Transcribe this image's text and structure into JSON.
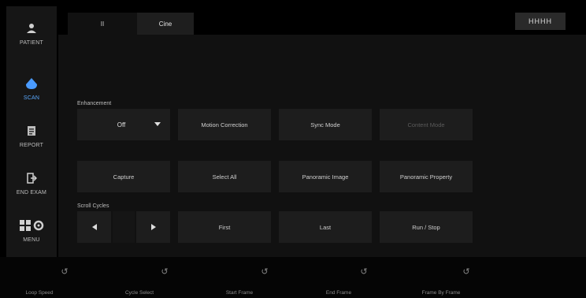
{
  "sidebar": {
    "items": [
      {
        "label": "PATIENT",
        "icon": "person-icon",
        "active": false
      },
      {
        "label": "SCAN",
        "icon": "probe-icon",
        "active": true
      },
      {
        "label": "REPORT",
        "icon": "report-icon",
        "active": false
      },
      {
        "label": "END EXAM",
        "icon": "exit-icon",
        "active": false
      },
      {
        "label": "MENU",
        "icon": "menu-gear-icon",
        "active": false
      }
    ]
  },
  "tabs": [
    {
      "label": "II"
    },
    {
      "label": "Cine"
    }
  ],
  "top_chip": {
    "label": "HHHH"
  },
  "enhancement": {
    "label": "Enhancement",
    "value": "Off"
  },
  "buttons": {
    "motion_correction": "Motion Correction",
    "sync_mode": "Sync Mode",
    "disabled_btn": "Content Mode",
    "capture": "Capture",
    "select_all": "Select All",
    "panoramic_image": "Panoramic Image",
    "panoramic_property": "Panoramic Property",
    "first": "First",
    "last": "Last",
    "run_stop": "Run / Stop"
  },
  "scroll_cycles": {
    "label": "Scroll Cycles"
  },
  "footer": {
    "knobs": [
      {
        "label": "Loop Speed",
        "icon": "rotary-knob-icon"
      },
      {
        "label": "Cycle Select",
        "icon": "rotary-knob-icon"
      },
      {
        "label": "Start Frame",
        "icon": "rotary-knob-icon"
      },
      {
        "label": "End Frame",
        "icon": "rotary-knob-icon"
      },
      {
        "label": "Frame By Frame",
        "icon": "rotary-knob-icon"
      }
    ]
  },
  "colors": {
    "accent": "#5aa9ff",
    "background": "#000000",
    "panel": "#111111",
    "button": "#1d1d1d"
  }
}
